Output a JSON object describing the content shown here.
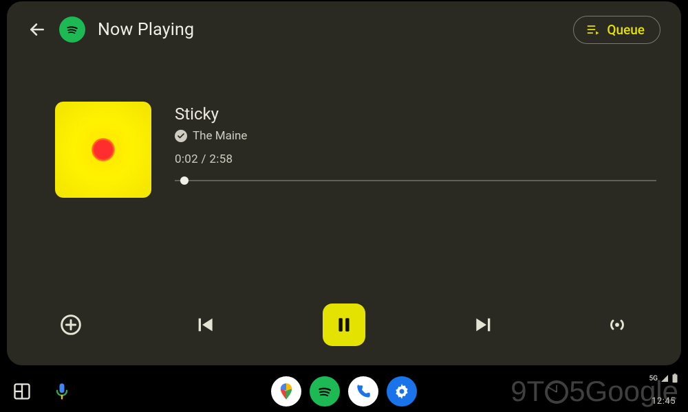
{
  "header": {
    "title": "Now Playing",
    "queue_label": "Queue"
  },
  "track": {
    "title": "Sticky",
    "artist": "The Maine",
    "elapsed": "0:02",
    "duration": "2:58",
    "progress_percent": 2
  },
  "controls": {
    "add": "add",
    "prev": "previous",
    "pause": "pause",
    "next": "next",
    "cast": "broadcast"
  },
  "system": {
    "network_label": "5G",
    "clock": "12:45"
  },
  "watermark": {
    "prefix": "9T",
    "suffix": "5Google"
  },
  "colors": {
    "accent": "#e4e200",
    "spotify_green": "#1DB954",
    "panel": "#2a2922"
  }
}
